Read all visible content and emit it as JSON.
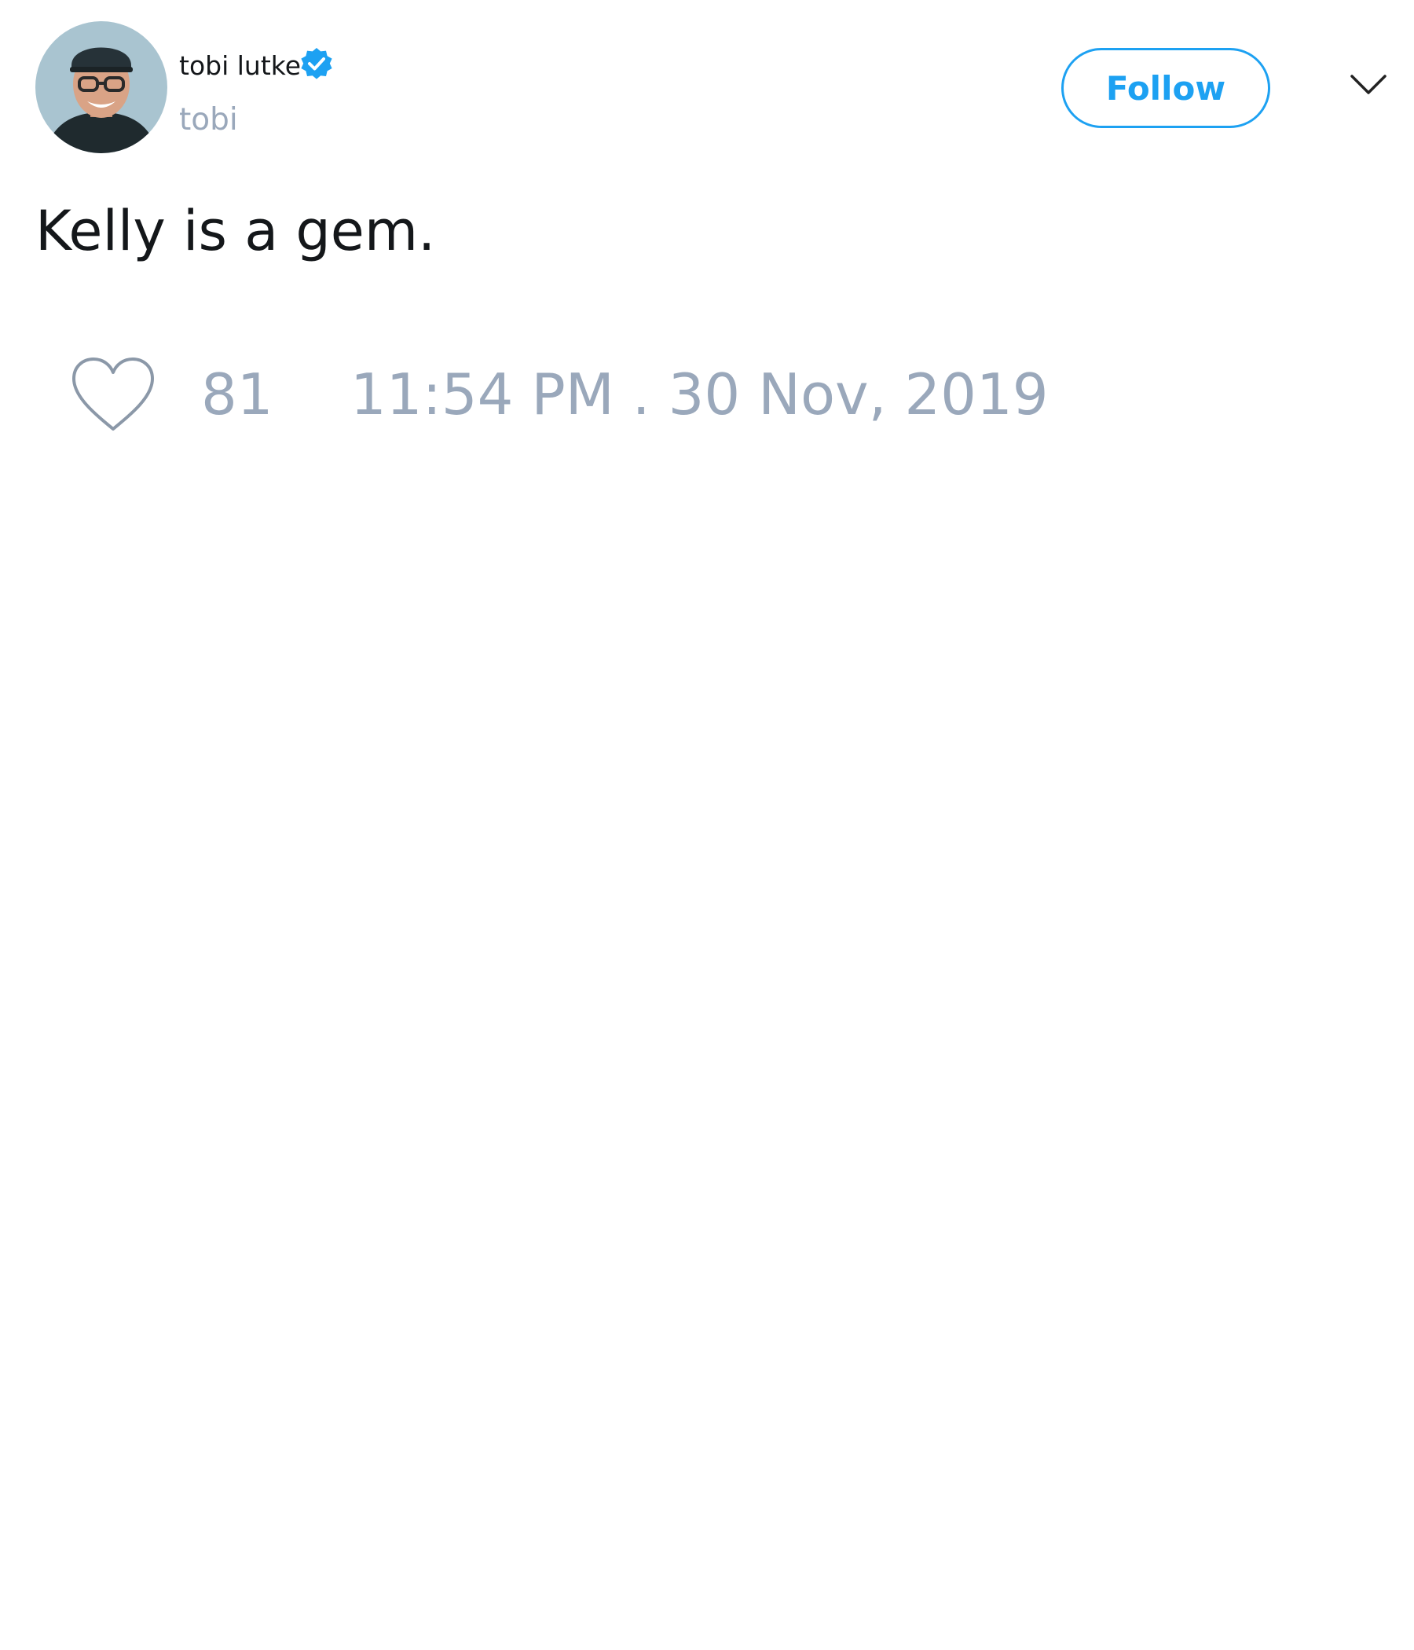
{
  "author": {
    "display_name": "tobi lutke",
    "handle": "tobi",
    "verified": true
  },
  "follow_button": {
    "label": "Follow"
  },
  "tweet": {
    "text": "Kelly is a gem.",
    "like_count": "81",
    "timestamp": "11:54 PM . 30 Nov, 2019"
  },
  "icons": {
    "verified": "verified-badge-icon",
    "menu": "chevron-down-icon",
    "like": "heart-icon"
  },
  "colors": {
    "accent": "#1da1f2",
    "text_primary": "#14171a",
    "text_secondary": "#9aa8bb",
    "background": "#ffffff"
  }
}
